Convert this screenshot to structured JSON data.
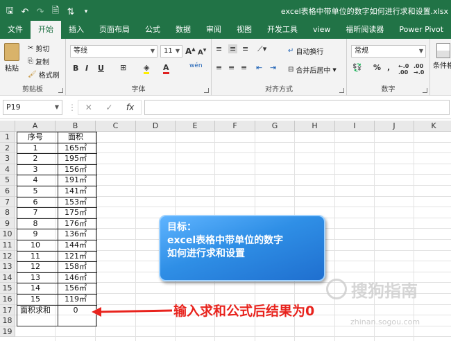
{
  "titlebar": {
    "quick_access": [
      "save-icon",
      "undo-icon",
      "redo-icon",
      "print-preview-icon",
      "sort-icon",
      "customize-icon"
    ],
    "filename": "excel表格中带单位的数字如何进行求和设置.xlsx"
  },
  "tabs": [
    "文件",
    "开始",
    "插入",
    "页面布局",
    "公式",
    "数据",
    "审阅",
    "视图",
    "开发工具",
    "view",
    "福昕阅读器",
    "Power Pivot"
  ],
  "active_tab": "开始",
  "ribbon": {
    "clipboard": {
      "paste": "粘贴",
      "cut": "剪切",
      "copy": "复制",
      "format_painter": "格式刷",
      "label": "剪贴板"
    },
    "font": {
      "font_name": "等线",
      "font_size": "11",
      "bold": "B",
      "italic": "I",
      "underline": "U",
      "label": "字体"
    },
    "alignment": {
      "wrap": "自动换行",
      "merge": "合并后居中",
      "label": "对齐方式"
    },
    "number": {
      "format": "常规",
      "label": "数字"
    },
    "styles": {
      "conditional": "条件格"
    }
  },
  "formula_bar": {
    "name_box": "P19",
    "cancel": "✕",
    "enter": "✓",
    "fx": "fx",
    "content": ""
  },
  "columns": [
    "A",
    "B",
    "C",
    "D",
    "E",
    "F",
    "G",
    "H",
    "I",
    "J",
    "K"
  ],
  "rows": [
    "1",
    "2",
    "3",
    "4",
    "5",
    "6",
    "7",
    "8",
    "9",
    "10",
    "11",
    "12",
    "13",
    "14",
    "15",
    "16",
    "17",
    "18",
    "19"
  ],
  "table": {
    "header": [
      "序号",
      "面积"
    ],
    "rows": [
      [
        "1",
        "165㎡"
      ],
      [
        "2",
        "195㎡"
      ],
      [
        "3",
        "156㎡"
      ],
      [
        "4",
        "191㎡"
      ],
      [
        "5",
        "141㎡"
      ],
      [
        "6",
        "153㎡"
      ],
      [
        "7",
        "175㎡"
      ],
      [
        "8",
        "176㎡"
      ],
      [
        "9",
        "136㎡"
      ],
      [
        "10",
        "144㎡"
      ],
      [
        "11",
        "121㎡"
      ],
      [
        "12",
        "158㎡"
      ],
      [
        "13",
        "146㎡"
      ],
      [
        "14",
        "156㎡"
      ],
      [
        "15",
        "119㎡"
      ]
    ],
    "total": [
      "面积求和",
      "0"
    ]
  },
  "callout": {
    "line1": "目标：",
    "line2": "excel表格中带单位的数字",
    "line3": "如何进行求和设置"
  },
  "annotation": "输入求和公式后结果为0",
  "watermark": {
    "text": "搜狗指南",
    "url": "zhinan.sogou.com"
  },
  "colors": {
    "excel_green": "#217346",
    "annotation_red": "#e8231d",
    "callout_blue": "#2f8fe6"
  }
}
